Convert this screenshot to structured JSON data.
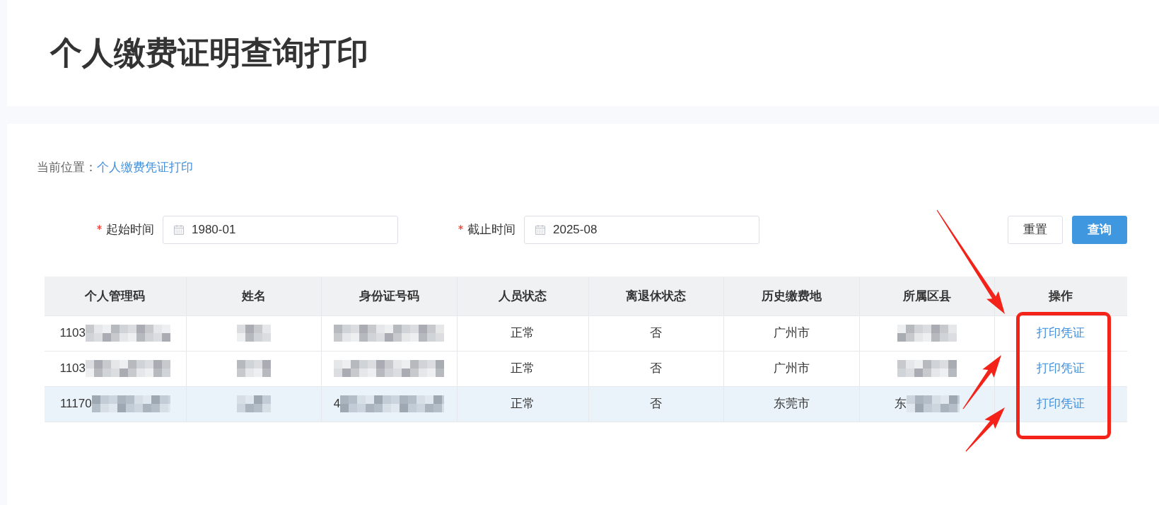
{
  "header": {
    "title": "个人缴费证明查询打印"
  },
  "breadcrumb": {
    "label": "当前位置：",
    "current": "个人缴费凭证打印"
  },
  "filters": [
    {
      "label": "起始时间",
      "required": true,
      "value": "1980-01"
    },
    {
      "label": "截止时间",
      "required": true,
      "value": "2025-08"
    }
  ],
  "buttons": [
    {
      "label": "重置",
      "kind": "secondary"
    },
    {
      "label": "查询",
      "kind": "primary"
    }
  ],
  "table": {
    "columns": [
      "个人管理码",
      "姓名",
      "身份证号码",
      "人员状态",
      "离退休状态",
      "历史缴费地",
      "所属区县",
      "操作"
    ],
    "rows": [
      {
        "highlighted": false,
        "cells": [
          {
            "text": "1103",
            "redacted": true
          },
          {
            "redacted": true
          },
          {
            "redacted": true
          },
          {
            "text": "正常",
            "redacted": false
          },
          {
            "text": "否",
            "redacted": false
          },
          {
            "text": "广州市",
            "redacted": false
          },
          {
            "redacted": true
          }
        ],
        "action": "打印凭证"
      },
      {
        "highlighted": false,
        "cells": [
          {
            "text": "1103",
            "redacted": true
          },
          {
            "redacted": true
          },
          {
            "redacted": true
          },
          {
            "text": "正常",
            "redacted": false
          },
          {
            "text": "否",
            "redacted": false
          },
          {
            "text": "广州市",
            "redacted": false
          },
          {
            "redacted": true
          }
        ],
        "action": "打印凭证"
      },
      {
        "highlighted": true,
        "cells": [
          {
            "text": "11170",
            "redacted": true
          },
          {
            "redacted": true
          },
          {
            "text": "4",
            "redacted": true
          },
          {
            "text": "正常",
            "redacted": false
          },
          {
            "text": "否",
            "redacted": false
          },
          {
            "text": "东莞市",
            "redacted": false
          },
          {
            "text": "东",
            "redacted": true
          }
        ],
        "action": "打印凭证"
      }
    ]
  }
}
